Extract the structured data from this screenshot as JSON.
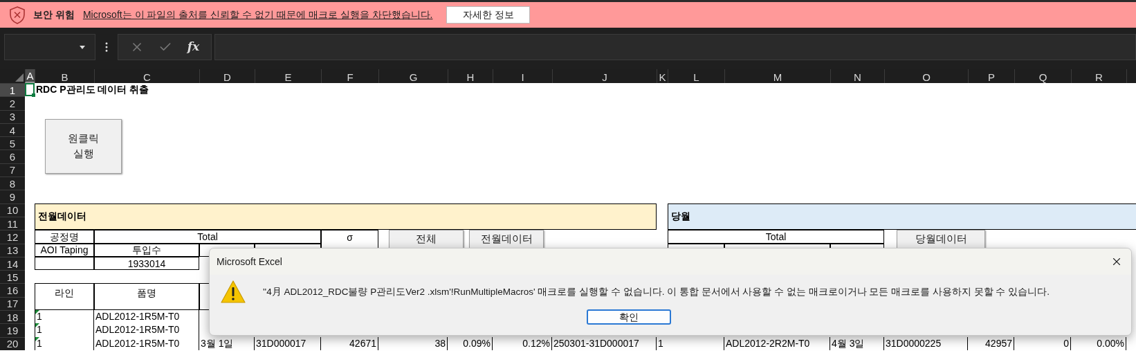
{
  "security_bar": {
    "label": "보안 위험",
    "message": "Microsoft는 이 파일의 출처를 신뢰할 수 없기 때문에 매크로 실행을 차단했습니다.",
    "button": "자세한 정보"
  },
  "formula_bar": {
    "fx": "fx"
  },
  "columns": [
    {
      "label": "A",
      "selected": true
    },
    {
      "label": "B",
      "selected": false
    },
    {
      "label": "C",
      "selected": false
    },
    {
      "label": "D",
      "selected": false
    },
    {
      "label": "E",
      "selected": false
    },
    {
      "label": "F",
      "selected": false
    },
    {
      "label": "G",
      "selected": false
    },
    {
      "label": "H",
      "selected": false
    },
    {
      "label": "I",
      "selected": false
    },
    {
      "label": "J",
      "selected": false
    },
    {
      "label": "K",
      "selected": false
    },
    {
      "label": "L",
      "selected": false
    },
    {
      "label": "M",
      "selected": false
    },
    {
      "label": "N",
      "selected": false
    },
    {
      "label": "O",
      "selected": false
    },
    {
      "label": "P",
      "selected": false
    },
    {
      "label": "Q",
      "selected": false
    },
    {
      "label": "R",
      "selected": false
    }
  ],
  "rows": [
    {
      "label": "1",
      "selected": true
    },
    {
      "label": "2",
      "selected": false
    },
    {
      "label": "3",
      "selected": false
    },
    {
      "label": "4",
      "selected": false
    },
    {
      "label": "5",
      "selected": false
    },
    {
      "label": "6",
      "selected": false
    },
    {
      "label": "7",
      "selected": false
    },
    {
      "label": "8",
      "selected": false
    },
    {
      "label": "9",
      "selected": false
    },
    {
      "label": "10",
      "selected": false
    },
    {
      "label": "11",
      "selected": false
    },
    {
      "label": "12",
      "selected": false
    },
    {
      "label": "13",
      "selected": false
    },
    {
      "label": "14",
      "selected": false
    },
    {
      "label": "15",
      "selected": false
    },
    {
      "label": "16",
      "selected": false
    },
    {
      "label": "17",
      "selected": false
    },
    {
      "label": "18",
      "selected": false
    },
    {
      "label": "19",
      "selected": false
    },
    {
      "label": "20",
      "selected": false
    }
  ],
  "sheet": {
    "title": "RDC P관리도 데이터 취출",
    "run_button": [
      "원클릭",
      "실행"
    ]
  },
  "prev_month": {
    "title": "전월데이터",
    "process_label": "공정명",
    "process": "AOI Taping",
    "total": "Total",
    "input_label": "투입수",
    "input": "1933014",
    "sigma": "σ",
    "buttons": [
      "전체",
      "전월데이터"
    ]
  },
  "current_month": {
    "title": "당월",
    "total": "Total",
    "button": "당월데이터"
  },
  "list_header": {
    "line": "라인",
    "item": "품명"
  },
  "list_rows": [
    {
      "warning": true,
      "cells": [
        "1",
        "ADL2012-1R5M-T0"
      ]
    },
    {
      "warning": true,
      "cells": [
        "1",
        "ADL2012-1R5M-T0"
      ]
    },
    {
      "warning": true,
      "cells": [
        "1",
        "ADL2012-1R5M-T0",
        "3월 1일",
        "31D000017",
        "42671",
        "38",
        "0.09%",
        "0.12%",
        "250301-31D000017",
        "1",
        "ADL2012-2R2M-T0",
        "4월 3일",
        "31D0000225",
        "42957",
        "0",
        "0.00%"
      ]
    }
  ],
  "dialog": {
    "title": "Microsoft Excel",
    "message": "''4月 ADL2012_RDC불량 P관리도Ver2 .xlsm'!RunMultipleMacros' 매크로를 실행할 수 없습니다. 이 통합 문서에서 사용할 수 없는 매크로이거나 모든 매크로를 사용하지 못할 수 있습니다.",
    "button": "확인"
  }
}
